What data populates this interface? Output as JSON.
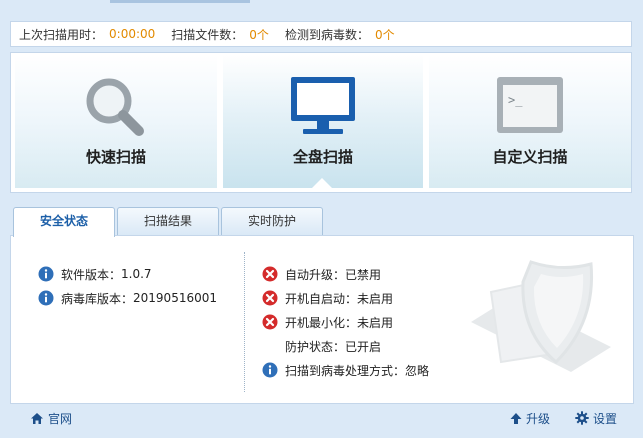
{
  "stats": {
    "last_scan_time_label": "上次扫描用时：",
    "last_scan_time_value": "0:00:00",
    "files_scanned_label": "扫描文件数：",
    "files_scanned_value": "0个",
    "viruses_found_label": "检测到病毒数：",
    "viruses_found_value": "0个"
  },
  "scan_modes": {
    "quick": "快速扫描",
    "full": "全盘扫描",
    "custom": "自定义扫描"
  },
  "tabs": [
    {
      "label": "安全状态"
    },
    {
      "label": "扫描结果"
    },
    {
      "label": "实时防护"
    }
  ],
  "status_left": [
    {
      "label": "软件版本：",
      "value": "1.0.7",
      "icon": "info-icon"
    },
    {
      "label": "病毒库版本：",
      "value": "20190516001",
      "icon": "info-icon"
    }
  ],
  "status_right": [
    {
      "text": "自动升级：已禁用",
      "icon": "error-icon"
    },
    {
      "text": "开机自启动：未启用",
      "icon": "error-icon"
    },
    {
      "text": "开机最小化：未启用",
      "icon": "error-icon"
    },
    {
      "text": "防护状态：已开启",
      "icon": ""
    },
    {
      "text": "扫描到病毒处理方式：忽略",
      "icon": "info-icon"
    }
  ],
  "footer": {
    "home": "官网",
    "upgrade": "升级",
    "settings": "设置"
  },
  "colors": {
    "accent_orange": "#e28a00",
    "brand_blue": "#1c5fa8",
    "error_red": "#d42b2b",
    "info_blue": "#2f6fb8"
  }
}
